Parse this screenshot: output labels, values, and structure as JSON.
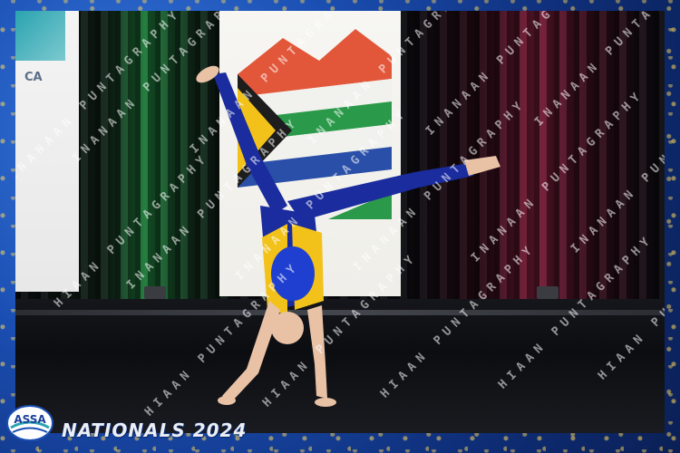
{
  "banner_left": {
    "text": "CA"
  },
  "watermark": {
    "text": "INANAAN PUNTAGRAPHY",
    "text_alt": "HIAAN PUNTAGRAPHY"
  },
  "logo": {
    "text": "ASSA",
    "icon": "organization-logo"
  },
  "event": {
    "title": "NATIONALS 2024"
  },
  "colors": {
    "frame_blue": "#1b4fb3",
    "leotard_blue": "#1a2c9e",
    "leotard_yellow": "#f2c21a",
    "curtain_green": "#1e7a3a",
    "curtain_magenta": "#7a1d3a"
  }
}
